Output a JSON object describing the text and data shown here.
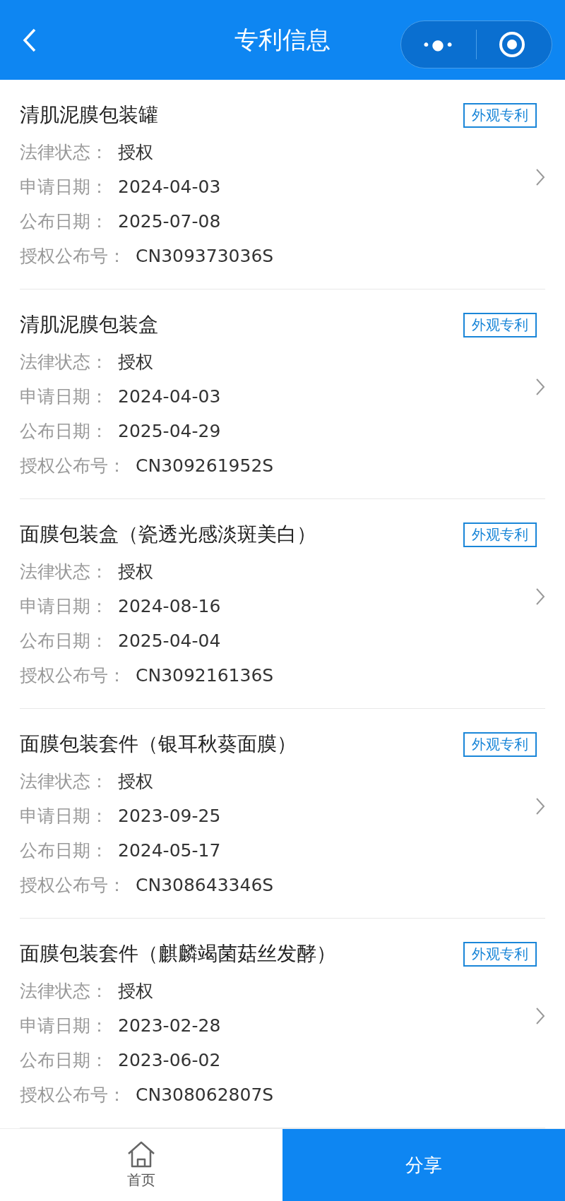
{
  "header": {
    "title": "专利信息",
    "menu_glyph": "•●•"
  },
  "patents": [
    {
      "title": "清肌泥膜包装罐",
      "tag": "外观专利",
      "fields": [
        {
          "label": "法律状态：",
          "value": "授权"
        },
        {
          "label": "申请日期：",
          "value": "2024-04-03"
        },
        {
          "label": "公布日期：",
          "value": "2025-07-08"
        },
        {
          "label": "授权公布号：",
          "value": "CN309373036S"
        }
      ]
    },
    {
      "title": "清肌泥膜包装盒",
      "tag": "外观专利",
      "fields": [
        {
          "label": "法律状态：",
          "value": "授权"
        },
        {
          "label": "申请日期：",
          "value": "2024-04-03"
        },
        {
          "label": "公布日期：",
          "value": "2025-04-29"
        },
        {
          "label": "授权公布号：",
          "value": "CN309261952S"
        }
      ]
    },
    {
      "title": "面膜包装盒（瓷透光感淡斑美白）",
      "tag": "外观专利",
      "fields": [
        {
          "label": "法律状态：",
          "value": "授权"
        },
        {
          "label": "申请日期：",
          "value": "2024-08-16"
        },
        {
          "label": "公布日期：",
          "value": "2025-04-04"
        },
        {
          "label": "授权公布号：",
          "value": "CN309216136S"
        }
      ]
    },
    {
      "title": "面膜包装套件（银耳秋葵面膜）",
      "tag": "外观专利",
      "fields": [
        {
          "label": "法律状态：",
          "value": "授权"
        },
        {
          "label": "申请日期：",
          "value": "2023-09-25"
        },
        {
          "label": "公布日期：",
          "value": "2024-05-17"
        },
        {
          "label": "授权公布号：",
          "value": "CN308643346S"
        }
      ]
    },
    {
      "title": "面膜包装套件（麒麟竭菌菇丝发酵）",
      "tag": "外观专利",
      "fields": [
        {
          "label": "法律状态：",
          "value": "授权"
        },
        {
          "label": "申请日期：",
          "value": "2023-02-28"
        },
        {
          "label": "公布日期：",
          "value": "2023-06-02"
        },
        {
          "label": "授权公布号：",
          "value": "CN308062807S"
        }
      ]
    }
  ],
  "bottom_bar": {
    "home_label": "首页",
    "share_label": "分享"
  }
}
